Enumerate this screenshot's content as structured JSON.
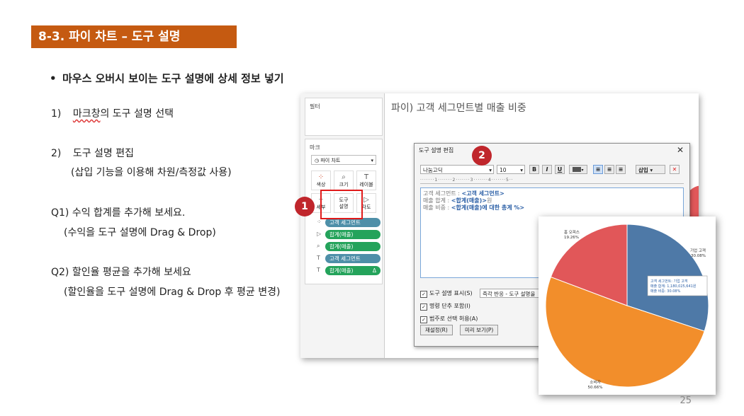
{
  "slide": {
    "title": "8-3. 파이 차트 – 도구 설명",
    "bullet": "마우스 오버시 보이는 도구 설명에 상세 정보 넣기",
    "steps": [
      {
        "num": "1)",
        "text_a": "마크창",
        "text_b": "의 도구 설명 선택"
      },
      {
        "num": "2)",
        "text": "도구 설명 편집",
        "sub": "(삽입 기능을 이용해 차원/측정값 사용)"
      }
    ],
    "q1": {
      "title": "Q1) 수익 합계를 추가해 보세요.",
      "sub": "(수익을 도구 설명에 Drag & Drop)"
    },
    "q2": {
      "title": "Q2) 할인율 평균을 추가해 보세요",
      "sub": "(할인율을 도구 설명에 Drag & Drop 후 평균 변경)"
    },
    "page_number": "25"
  },
  "app": {
    "filter_label": "필터",
    "marks_label": "마크",
    "mark_type": "◷ 파이 차트",
    "mark_buttons": [
      {
        "label": "색상",
        "icon": "⁘"
      },
      {
        "label": "크기",
        "icon": "⌕"
      },
      {
        "label": "레이블",
        "icon": "T"
      },
      {
        "label": "세부",
        "icon": "⁘"
      },
      {
        "label": "도구\n설명",
        "icon": ""
      },
      {
        "label": "각도",
        "icon": "▷"
      }
    ],
    "pills": [
      {
        "icon": "⁘",
        "label": "고객 세그먼트",
        "color": "#4e8fa8"
      },
      {
        "icon": "▷",
        "label": "합계(매출)",
        "color": "#24a35b"
      },
      {
        "icon": "⌕",
        "label": "합계(매출)",
        "color": "#24a35b"
      },
      {
        "icon": "T",
        "label": "고객 세그먼트",
        "color": "#4e8fa8"
      },
      {
        "icon": "T",
        "label": "합계(매출)",
        "color": "#24a35b",
        "suffix": "Δ"
      }
    ],
    "sheet_title": "파이) 고객 세그먼트별 매출 비중"
  },
  "dialog": {
    "title": "도구 설명 편집",
    "close": "✕",
    "font": "나눔고딕",
    "size": "10",
    "bold": "B",
    "italic": "I",
    "underline": "U",
    "insert": "삽입 ▾",
    "clear": "✕",
    "ruler": "·······1·······2·······3·······4·······5··",
    "lines": [
      {
        "label": "고객 세그먼트 : ",
        "field": "<고객 세그먼트>",
        "tail": ""
      },
      {
        "label": "매출 합계 : ",
        "field": "<합계(매출)>",
        "tail": "원"
      },
      {
        "label": "매출 비중 : ",
        "field": "<합계(매출)에 대한 총계 %>",
        "tail": ""
      }
    ],
    "check_show": "도구 설명 표시(S)",
    "response": "즉각 반응 - 도구 설명을",
    "check_cmd": "명령 단추 포함(I)",
    "check_select": "범주로 선택 허용(A)",
    "reset": "재설정(R)",
    "preview": "미리 보기(P)"
  },
  "badges": {
    "one": "1",
    "two": "2"
  },
  "chart_data": {
    "type": "pie",
    "categories": [
      "기업 고객",
      "소비자",
      "홈 오피스"
    ],
    "values": [
      30.08,
      50.66,
      19.26
    ],
    "slice_labels": [
      "기업 고객\n30.08%",
      "소비자\n50.66%",
      "홈 오피스\n19.26%"
    ],
    "colors": [
      "#4e79a7",
      "#f28e2b",
      "#e15759"
    ],
    "tooltip": [
      "고객 세그먼트:  기업 고객",
      "매출 합계:  1,180,025,641원",
      "매출 비중:  30.08%"
    ]
  }
}
